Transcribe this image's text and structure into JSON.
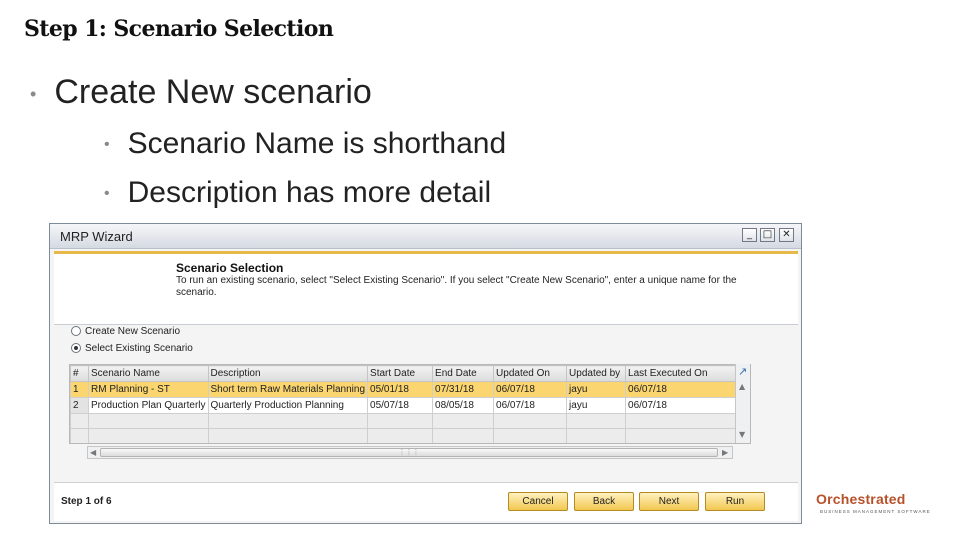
{
  "slide": {
    "title": "Step 1: Scenario Selection",
    "bullets": [
      {
        "text": "Create New scenario"
      },
      {
        "text": "Scenario Name is shorthand"
      },
      {
        "text": "Description has more detail"
      }
    ]
  },
  "window": {
    "title": "MRP Wizard",
    "controls": {
      "minimize": "_",
      "maximize": "□",
      "close": "✕"
    },
    "header": {
      "title": "Scenario Selection",
      "description": "To run an existing scenario, select \"Select Existing Scenario\". If you select \"Create New Scenario\", enter a unique name for the scenario."
    },
    "options": [
      {
        "label": "Create New Scenario",
        "selected": false
      },
      {
        "label": "Select Existing Scenario",
        "selected": true
      }
    ],
    "grid": {
      "columns": [
        "#",
        "Scenario Name",
        "Description",
        "Start Date",
        "End Date",
        "Updated On",
        "Updated by",
        "Last Executed On"
      ],
      "rows": [
        [
          "1",
          "RM Planning - ST",
          "Short term Raw Materials Planning",
          "05/01/18",
          "07/31/18",
          "06/07/18",
          "jayu",
          "06/07/18"
        ],
        [
          "2",
          "Production Plan Quarterly",
          "Quarterly Production Planning",
          "05/07/18",
          "08/05/18",
          "06/07/18",
          "jayu",
          "06/07/18"
        ]
      ],
      "selected_row": 0,
      "colors": {
        "selected": "#fbd56f"
      }
    },
    "footer": {
      "step": "Step 1 of 6",
      "buttons": [
        "Cancel",
        "Back",
        "Next",
        "Run"
      ]
    }
  },
  "logo": {
    "name": "Orchestrated",
    "tagline": "BUSINESS MANAGEMENT SOFTWARE",
    "color": "#b7512a"
  }
}
